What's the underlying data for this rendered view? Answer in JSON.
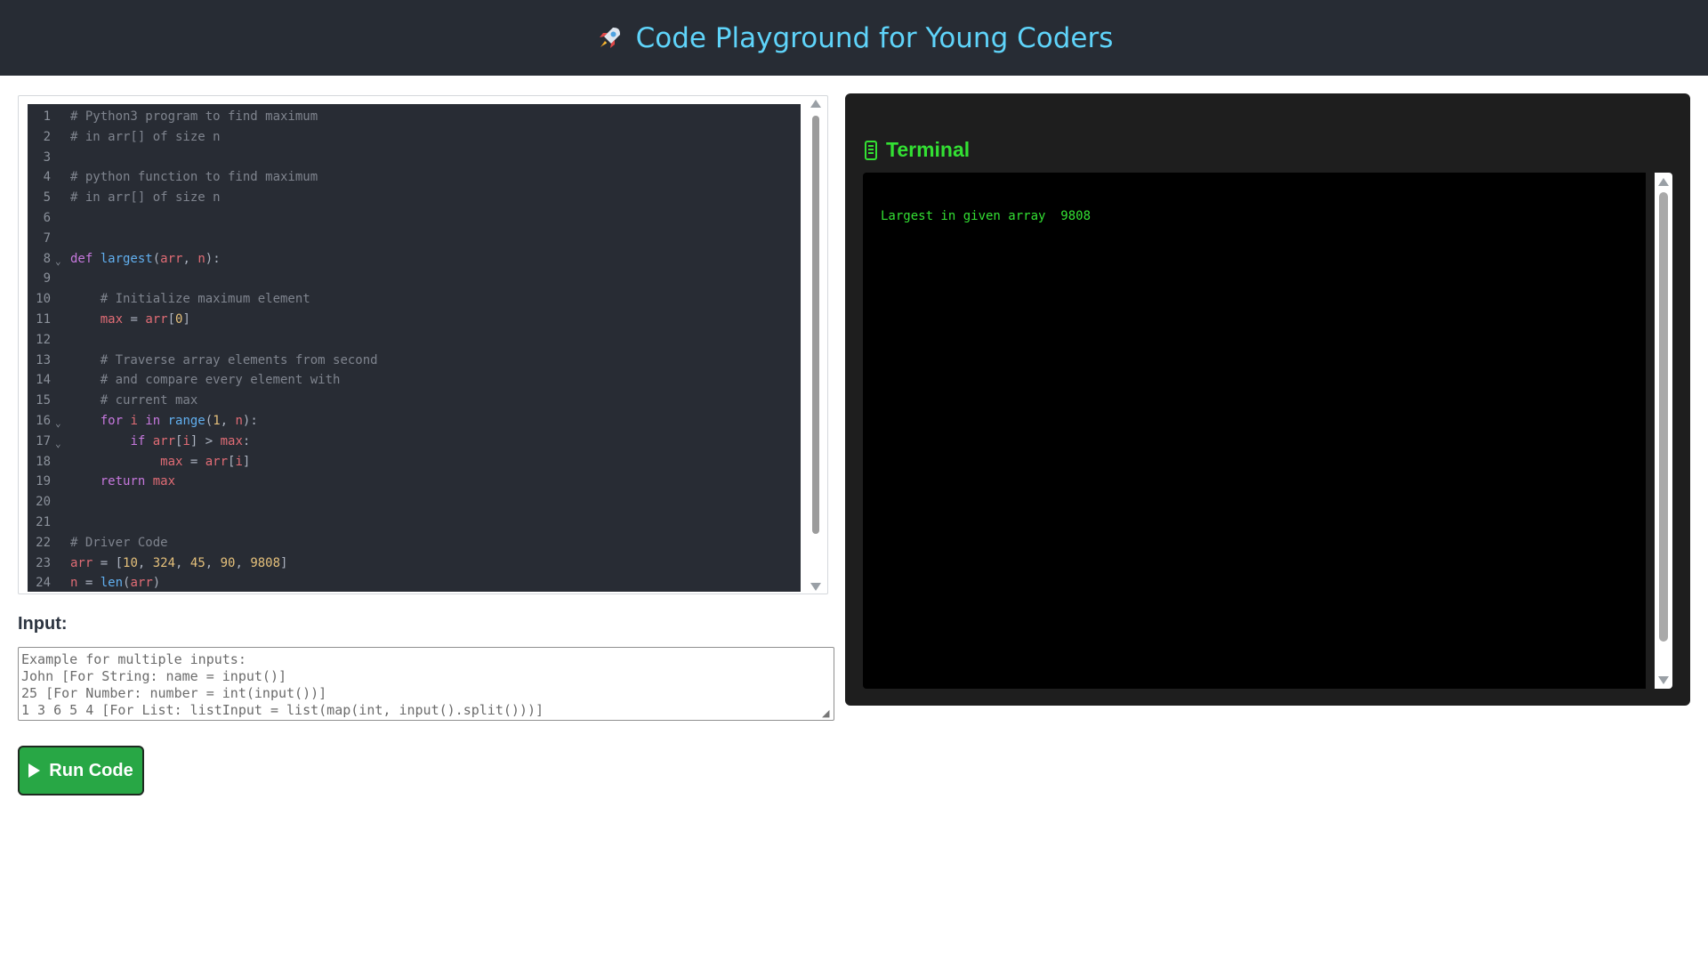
{
  "header": {
    "title": "Code Playground for Young Coders",
    "icon": "rocket-icon"
  },
  "editor": {
    "lines": [
      {
        "n": "1",
        "fold": false,
        "tokens": [
          [
            "comment",
            "# Python3 program to find maximum"
          ]
        ]
      },
      {
        "n": "2",
        "fold": false,
        "tokens": [
          [
            "comment",
            "# in arr[] of size n"
          ]
        ]
      },
      {
        "n": "3",
        "fold": false,
        "tokens": []
      },
      {
        "n": "4",
        "fold": false,
        "tokens": [
          [
            "comment",
            "# python function to find maximum"
          ]
        ]
      },
      {
        "n": "5",
        "fold": false,
        "tokens": [
          [
            "comment",
            "# in arr[] of size n"
          ]
        ]
      },
      {
        "n": "6",
        "fold": false,
        "tokens": []
      },
      {
        "n": "7",
        "fold": false,
        "tokens": []
      },
      {
        "n": "8",
        "fold": true,
        "tokens": [
          [
            "kw",
            "def "
          ],
          [
            "fn",
            "largest"
          ],
          [
            "op",
            "("
          ],
          [
            "var",
            "arr"
          ],
          [
            "op",
            ", "
          ],
          [
            "var",
            "n"
          ],
          [
            "op",
            "):"
          ]
        ]
      },
      {
        "n": "9",
        "fold": false,
        "tokens": []
      },
      {
        "n": "10",
        "fold": false,
        "tokens": [
          [
            "op",
            "    "
          ],
          [
            "comment",
            "# Initialize maximum element"
          ]
        ]
      },
      {
        "n": "11",
        "fold": false,
        "tokens": [
          [
            "op",
            "    "
          ],
          [
            "var",
            "max"
          ],
          [
            "op",
            " = "
          ],
          [
            "var",
            "arr"
          ],
          [
            "op",
            "["
          ],
          [
            "num",
            "0"
          ],
          [
            "op",
            "]"
          ]
        ]
      },
      {
        "n": "12",
        "fold": false,
        "tokens": []
      },
      {
        "n": "13",
        "fold": false,
        "tokens": [
          [
            "op",
            "    "
          ],
          [
            "comment",
            "# Traverse array elements from second"
          ]
        ]
      },
      {
        "n": "14",
        "fold": false,
        "tokens": [
          [
            "op",
            "    "
          ],
          [
            "comment",
            "# and compare every element with"
          ]
        ]
      },
      {
        "n": "15",
        "fold": false,
        "tokens": [
          [
            "op",
            "    "
          ],
          [
            "comment",
            "# current max"
          ]
        ]
      },
      {
        "n": "16",
        "fold": true,
        "tokens": [
          [
            "op",
            "    "
          ],
          [
            "kw",
            "for "
          ],
          [
            "var",
            "i"
          ],
          [
            "kw",
            " in "
          ],
          [
            "builtin",
            "range"
          ],
          [
            "op",
            "("
          ],
          [
            "num",
            "1"
          ],
          [
            "op",
            ", "
          ],
          [
            "var",
            "n"
          ],
          [
            "op",
            "):"
          ]
        ]
      },
      {
        "n": "17",
        "fold": true,
        "tokens": [
          [
            "op",
            "        "
          ],
          [
            "kw",
            "if "
          ],
          [
            "var",
            "arr"
          ],
          [
            "op",
            "["
          ],
          [
            "var",
            "i"
          ],
          [
            "op",
            "] > "
          ],
          [
            "var",
            "max"
          ],
          [
            "op",
            ":"
          ]
        ]
      },
      {
        "n": "18",
        "fold": false,
        "tokens": [
          [
            "op",
            "            "
          ],
          [
            "var",
            "max"
          ],
          [
            "op",
            " = "
          ],
          [
            "var",
            "arr"
          ],
          [
            "op",
            "["
          ],
          [
            "var",
            "i"
          ],
          [
            "op",
            "]"
          ]
        ]
      },
      {
        "n": "19",
        "fold": false,
        "tokens": [
          [
            "op",
            "    "
          ],
          [
            "kw",
            "return "
          ],
          [
            "var",
            "max"
          ]
        ]
      },
      {
        "n": "20",
        "fold": false,
        "tokens": []
      },
      {
        "n": "21",
        "fold": false,
        "tokens": []
      },
      {
        "n": "22",
        "fold": false,
        "tokens": [
          [
            "comment",
            "# Driver Code"
          ]
        ]
      },
      {
        "n": "23",
        "fold": false,
        "tokens": [
          [
            "var",
            "arr"
          ],
          [
            "op",
            " = ["
          ],
          [
            "num",
            "10"
          ],
          [
            "op",
            ", "
          ],
          [
            "num",
            "324"
          ],
          [
            "op",
            ", "
          ],
          [
            "num",
            "45"
          ],
          [
            "op",
            ", "
          ],
          [
            "num",
            "90"
          ],
          [
            "op",
            ", "
          ],
          [
            "num",
            "9808"
          ],
          [
            "op",
            "]"
          ]
        ]
      },
      {
        "n": "24",
        "fold": false,
        "tokens": [
          [
            "var",
            "n"
          ],
          [
            "op",
            " = "
          ],
          [
            "builtin",
            "len"
          ],
          [
            "op",
            "("
          ],
          [
            "var",
            "arr"
          ],
          [
            "op",
            ")"
          ]
        ]
      }
    ]
  },
  "input": {
    "label": "Input:",
    "placeholder_lines": [
      "Example for multiple inputs:",
      "John [For String: name = input()]",
      "25 [For Number: number = int(input())]",
      "1 3 6 5 4 [For List: listInput = list(map(int, input().split()))]"
    ]
  },
  "run_button": {
    "label": "Run Code",
    "icon": "play-icon"
  },
  "terminal": {
    "title": "Terminal",
    "icon": "terminal-icon",
    "output": "Largest in given array  9808"
  },
  "colors": {
    "header_bg": "#272c34",
    "header_text": "#5fd4fa",
    "editor_bg": "#282c34",
    "terminal_green": "#33e033",
    "run_button": "#28a745"
  }
}
